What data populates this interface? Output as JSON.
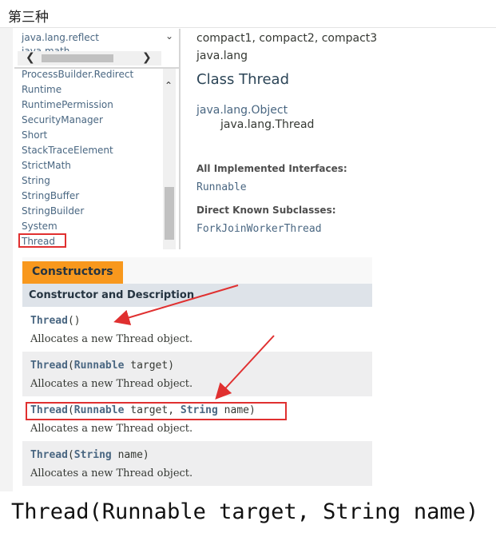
{
  "window": {
    "title": "第三种"
  },
  "packages": {
    "items": [
      "java.lang.reflect",
      "java.math"
    ]
  },
  "classes": {
    "items": [
      "ProcessBuilder.Redirect",
      "Runtime",
      "RuntimePermission",
      "SecurityManager",
      "Short",
      "StackTraceElement",
      "StrictMath",
      "String",
      "StringBuffer",
      "StringBuilder",
      "System",
      "Thread"
    ],
    "selected": "Thread"
  },
  "content": {
    "profiles": "compact1, compact2, compact3",
    "package": "java.lang",
    "class_title": "Class Thread",
    "inheritance_parent": "java.lang.Object",
    "inheritance_child": "java.lang.Thread",
    "interfaces_label": "All Implemented Interfaces:",
    "interfaces_value": "Runnable",
    "subclasses_label": "Direct Known Subclasses:",
    "subclasses_value": "ForkJoinWorkerThread"
  },
  "constructors": {
    "tab_label": "Constructors",
    "header": "Constructor and Description",
    "rows": [
      {
        "name": "Thread",
        "open": "(",
        "p1type": "",
        "p1name": "",
        "sep": "",
        "p2type": "",
        "p2name": "",
        "close": ")",
        "desc": "Allocates a new Thread object."
      },
      {
        "name": "Thread",
        "open": "(",
        "p1type": "Runnable",
        "p1name": " target",
        "sep": "",
        "p2type": "",
        "p2name": "",
        "close": ")",
        "desc": "Allocates a new Thread object."
      },
      {
        "name": "Thread",
        "open": "(",
        "p1type": "Runnable",
        "p1name": " target",
        "sep": ", ",
        "p2type": "String",
        "p2name": " name",
        "close": ")",
        "desc": "Allocates a new Thread object."
      },
      {
        "name": "Thread",
        "open": "(",
        "p1type": "String",
        "p1name": " name",
        "sep": "",
        "p2type": "",
        "p2name": "",
        "close": ")",
        "desc": "Allocates a new Thread object."
      }
    ]
  },
  "caption": "Thread(Runnable target, String name)",
  "colors": {
    "annotation": "#e03030",
    "tab": "#f8981d",
    "link": "#4a6782"
  }
}
